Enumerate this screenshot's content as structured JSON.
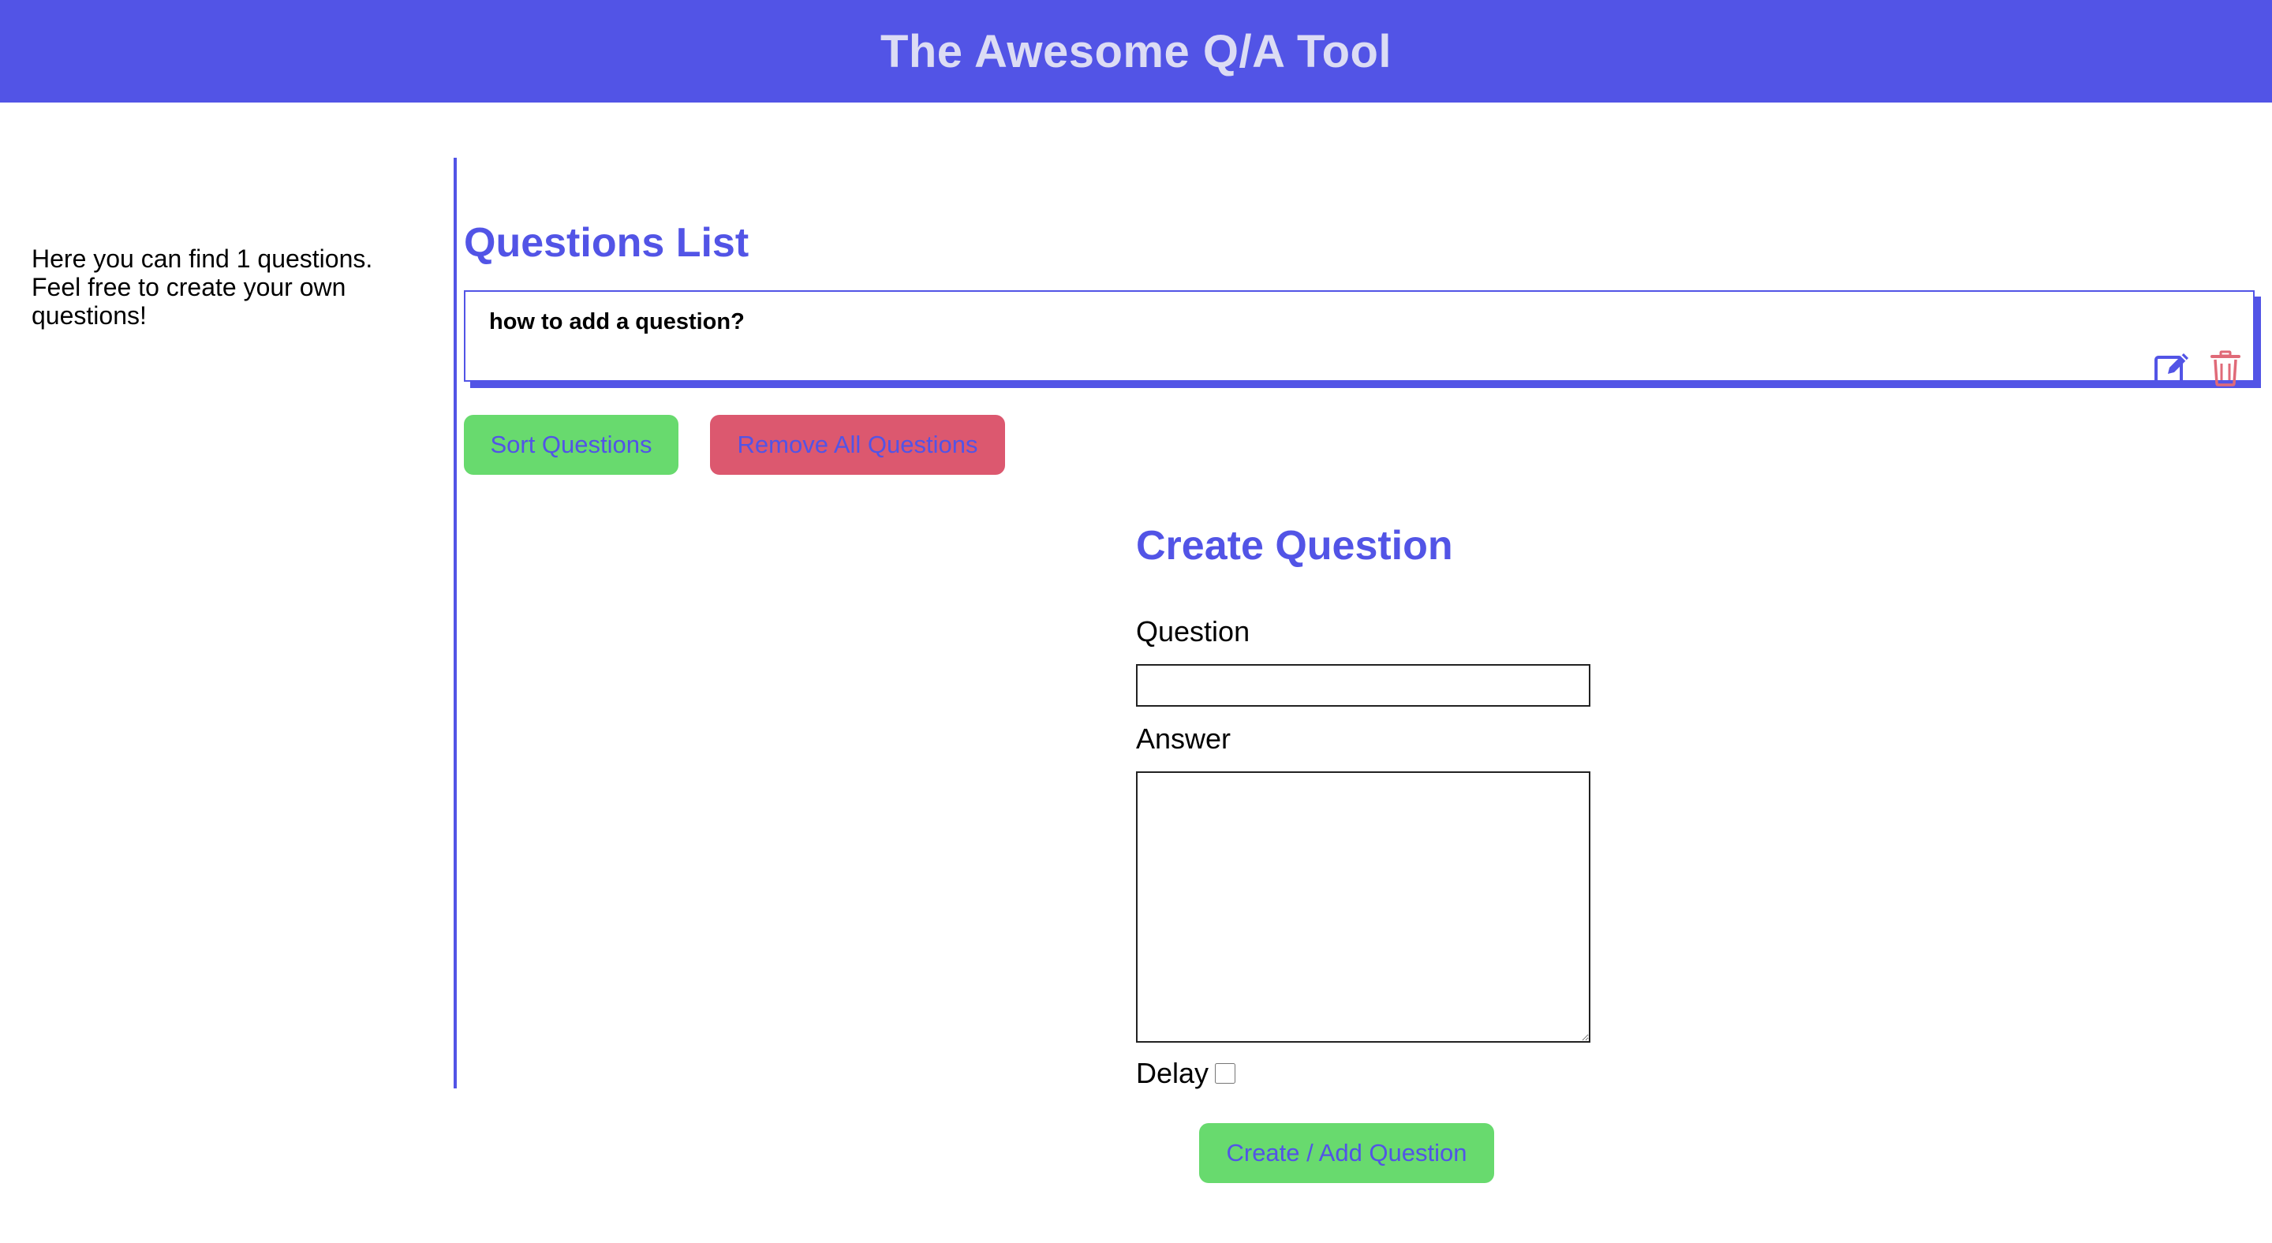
{
  "header": {
    "title": "The Awesome Q/A Tool"
  },
  "sidebar": {
    "info_text": "Here you can find 1 questions. Feel free to create your own questions!"
  },
  "questions_list": {
    "title": "Questions List",
    "items": [
      {
        "question": "how to add a question?"
      }
    ],
    "edit_icon": "edit-icon",
    "delete_icon": "trash-icon"
  },
  "actions": {
    "sort_label": "Sort Questions",
    "remove_all_label": "Remove All Questions"
  },
  "create_form": {
    "title": "Create Question",
    "question_label": "Question",
    "question_value": "",
    "answer_label": "Answer",
    "answer_value": "",
    "delay_label": "Delay",
    "delay_checked": false,
    "submit_label": "Create / Add Question"
  },
  "colors": {
    "primary": "#5254e6",
    "header_text": "#dcdcf4",
    "button_green": "#68da6e",
    "button_red": "#dc586f",
    "trash_icon": "#e06a78"
  }
}
